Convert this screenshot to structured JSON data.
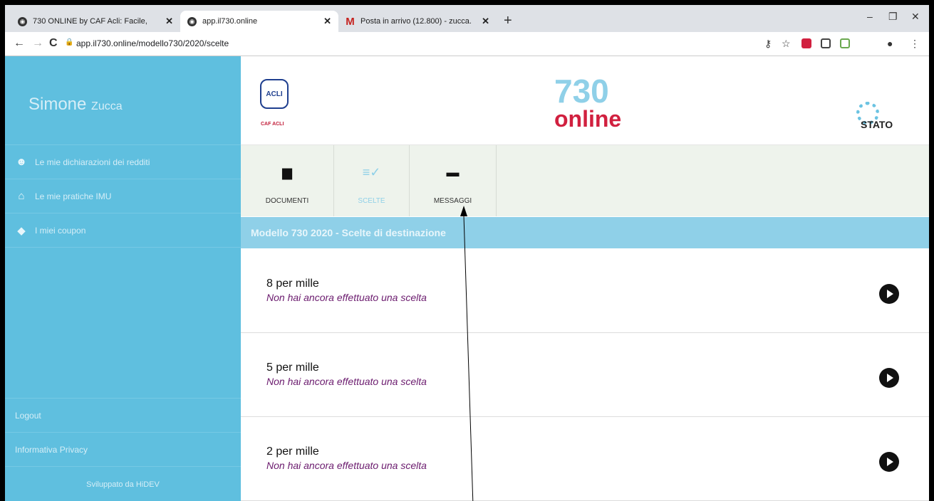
{
  "browser": {
    "tabs": [
      {
        "title": "730 ONLINE by CAF Acli: Facile,",
        "close": "✕",
        "active": false
      },
      {
        "title": "app.il730.online",
        "close": "✕",
        "active": true
      },
      {
        "title": "Posta in arrivo (12.800) - zucca.",
        "close": "✕",
        "active": false
      }
    ],
    "new_tab": "+",
    "url": "app.il730.online/modello730/2020/scelte"
  },
  "sidebar": {
    "user_first": "Simone",
    "user_last": "Zucca",
    "items": [
      {
        "label": "Le mie dichiarazioni dei redditi",
        "icon": "user-icon"
      },
      {
        "label": "Le mie pratiche IMU",
        "icon": "home-icon"
      },
      {
        "label": "I miei coupon",
        "icon": "tag-icon"
      }
    ],
    "logout": "Logout",
    "privacy": "Informativa Privacy",
    "developed_by": "Sviluppato da HiDEV"
  },
  "header": {
    "logo_text": "ACLI",
    "logo_caption": "CAF ACLI",
    "brand_number": "730",
    "brand_word": "online",
    "status_label": "STATO"
  },
  "toolbar": [
    {
      "label": "DOCUMENTI",
      "icon": "document-icon",
      "selected": false
    },
    {
      "label": "SCELTE",
      "icon": "checklist-icon",
      "selected": true
    },
    {
      "label": "MESSAGGI",
      "icon": "message-icon",
      "selected": false
    }
  ],
  "section_title": "Modello 730 2020 - Scelte di destinazione",
  "choices": [
    {
      "title": "8 per mille",
      "subtitle": "Non hai ancora effettuato una scelta"
    },
    {
      "title": "5 per mille",
      "subtitle": "Non hai ancora effettuato una scelta"
    },
    {
      "title": "2 per mille",
      "subtitle": "Non hai ancora effettuato una scelta"
    }
  ],
  "colors": {
    "sidebar": "#5fbfdf",
    "accent": "#8fd0e8",
    "brand_red": "#d1203f",
    "subtitle": "#6b1b6e"
  }
}
